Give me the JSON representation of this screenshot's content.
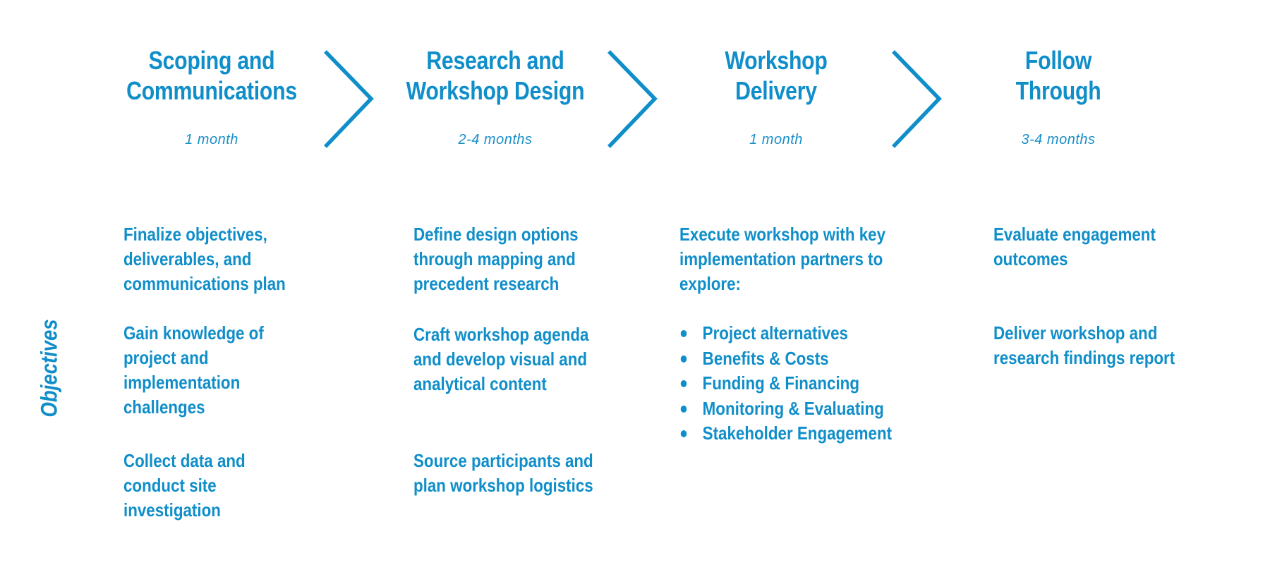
{
  "colors": {
    "accent": "#0f8ec9"
  },
  "side_label": "Objectives",
  "stages": [
    {
      "title": "Scoping and\nCommunications",
      "duration": "1 month"
    },
    {
      "title": "Research and\nWorkshop Design",
      "duration": "2-4 months"
    },
    {
      "title": "Workshop\nDelivery",
      "duration": "1 month"
    },
    {
      "title": "Follow\nThrough",
      "duration": "3-4 months"
    }
  ],
  "arrows": [
    "chevron-right-icon",
    "chevron-right-icon",
    "chevron-right-icon"
  ],
  "objectives": {
    "scoping": [
      "Finalize objectives,\ndeliverables, and\ncommunications plan",
      "Gain knowledge of\nproject and\nimplementation\nchallenges",
      "Collect data and\nconduct site\ninvestigation"
    ],
    "research": [
      "Define design options\nthrough  mapping and\nprecedent research",
      "Craft workshop agenda\nand develop visual and\nanalytical content",
      "Source participants and\nplan workshop logistics"
    ],
    "delivery": {
      "intro": "Execute workshop with key\nimplementation partners to\nexplore:",
      "bullets": [
        "Project alternatives",
        "Benefits & Costs",
        "Funding & Financing",
        "Monitoring & Evaluating",
        "Stakeholder Engagement"
      ]
    },
    "follow": [
      "Evaluate engagement\noutcomes",
      "Deliver workshop and\nresearch findings report"
    ]
  }
}
